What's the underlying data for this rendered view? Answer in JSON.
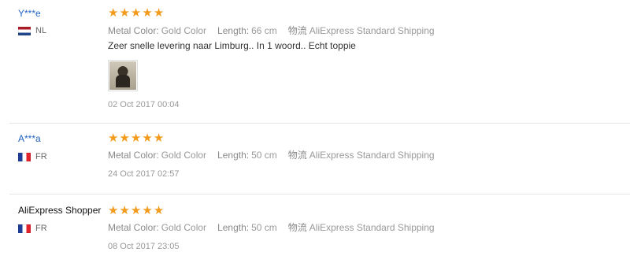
{
  "reviews": [
    {
      "user": "Y***e",
      "country_code": "NL",
      "stars": 5,
      "metal_color_label": "Metal Color:",
      "metal_color_value": "Gold Color",
      "length_label": "Length:",
      "length_value": "66 cm",
      "shipping_label": "物流",
      "shipping_value": "AliExpress Standard Shipping",
      "feedback": "Zeer snelle levering naar Limburg.. In 1 woord.. Echt toppie",
      "date": "02 Oct 2017 00:04"
    },
    {
      "user": "A***a",
      "country_code": "FR",
      "stars": 5,
      "metal_color_label": "Metal Color:",
      "metal_color_value": "Gold Color",
      "length_label": "Length:",
      "length_value": "50 cm",
      "shipping_label": "物流",
      "shipping_value": "AliExpress Standard Shipping",
      "date": "24 Oct 2017 02:57"
    },
    {
      "user": "AliExpress Shopper",
      "country_code": "FR",
      "stars": 5,
      "metal_color_label": "Metal Color:",
      "metal_color_value": "Gold Color",
      "length_label": "Length:",
      "length_value": "50 cm",
      "shipping_label": "物流",
      "shipping_value": "AliExpress Standard Shipping",
      "date": "08 Oct 2017 23:05"
    }
  ],
  "colors": {
    "star": "#f29b1d",
    "username_link": "#2466c1"
  },
  "icons": {
    "star": "star-icon",
    "flag_nl": "flag-nl-icon",
    "flag_fr": "flag-fr-icon"
  }
}
